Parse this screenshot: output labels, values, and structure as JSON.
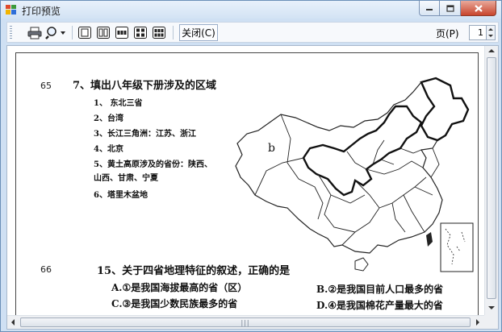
{
  "window": {
    "title": "打印预览"
  },
  "toolbar": {
    "buttons": [
      {
        "name": "print-button",
        "icon": "printer-icon"
      },
      {
        "name": "zoom-button",
        "icon": "magnifier-icon"
      },
      {
        "name": "one-page-button",
        "icon": "one-page-icon"
      },
      {
        "name": "two-pages-button",
        "icon": "two-pages-icon"
      },
      {
        "name": "three-pages-button",
        "icon": "three-pages-icon"
      },
      {
        "name": "four-pages-button",
        "icon": "four-pages-icon"
      },
      {
        "name": "six-pages-button",
        "icon": "six-pages-icon"
      }
    ],
    "close_label": "关闭(C)",
    "page_label": "页(P)",
    "page_value": "1"
  },
  "document": {
    "q65_num": "65",
    "q65_title": "7、填出八年级下册涉及的区域",
    "q65_items": [
      "1、 东北三省",
      "2、台湾",
      "3、长江三角洲：江苏、浙江",
      "4、北京",
      "5、黄土高原涉及的省份：陕西、",
      "山西、甘肃、宁夏",
      "6、塔里木盆地"
    ],
    "map_label": "b",
    "q66_num": "66",
    "q66_title": "15、关于四省地理特征的叙述，正确的是",
    "options": {
      "a": "A.①是我国海拔最高的省（区）",
      "b": "B.②是我国目前人口最多的省",
      "c": "C.③是我国少数民族最多的省",
      "d": "D.④是我国棉花产量最大的省"
    }
  }
}
